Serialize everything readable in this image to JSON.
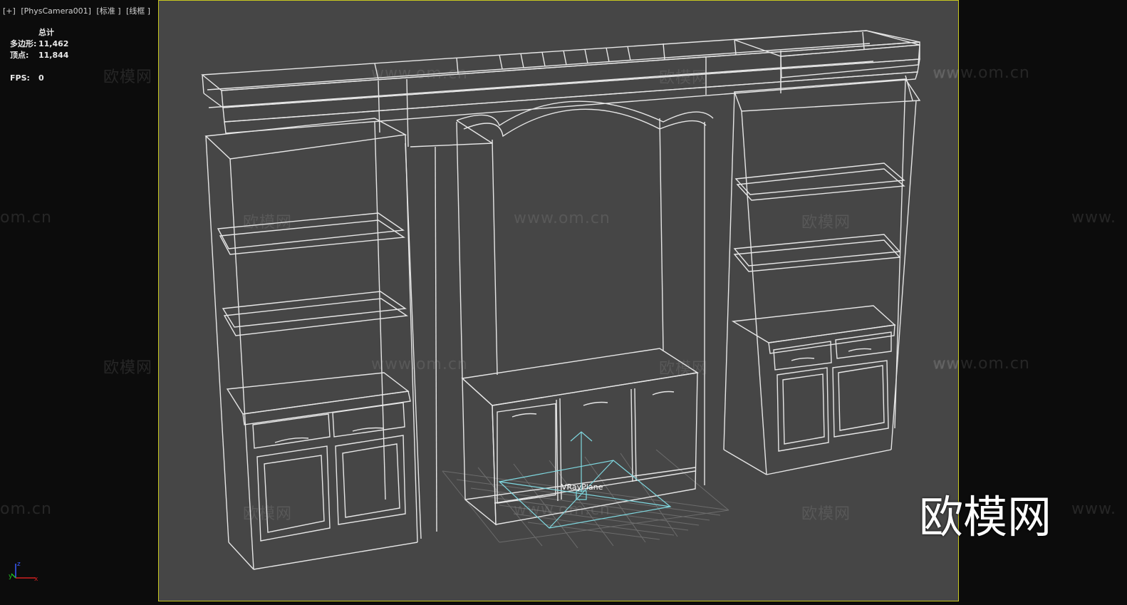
{
  "viewport_label": {
    "plus": "[+]",
    "camera": "[PhysCamera001]",
    "shading": "[标准 ]",
    "mode": "[线框 ]"
  },
  "stats": {
    "header": "总计",
    "polys_label": "多边形:",
    "polys_value": "11,462",
    "verts_label": "顶点:",
    "verts_value": "11,844",
    "fps_label": "FPS:",
    "fps_value": "0"
  },
  "scene": {
    "object_label": "VRayPlane"
  },
  "watermarks": {
    "cn": "欧模网",
    "url": "www.om.cn",
    "url_short": "om.cn",
    "url_prefix": "www.",
    "big": "欧模网"
  },
  "axis": {
    "x": "x",
    "y": "y",
    "z": "z"
  },
  "colors": {
    "viewport_bg": "#464646",
    "frame_border": "#c8c820",
    "wire": "#e6e6e6",
    "helper": "#7fd8e0"
  }
}
